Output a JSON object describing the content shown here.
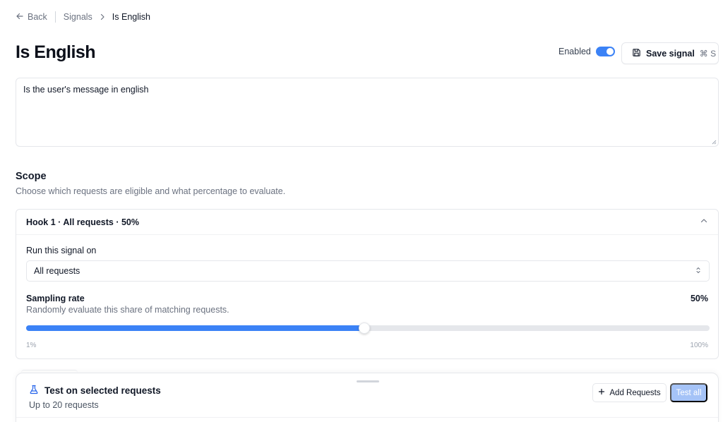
{
  "breadcrumb": {
    "back_label": "Back",
    "parent_label": "Signals",
    "current_label": "Is English"
  },
  "header": {
    "title": "Is English",
    "enabled_label": "Enabled",
    "enabled": true,
    "save_label": "Save signal",
    "save_shortcut": "⌘ S"
  },
  "prompt": {
    "value": "Is the user's message in english"
  },
  "scope": {
    "title": "Scope",
    "description": "Choose which requests are eligible and what percentage to evaluate.",
    "hook": {
      "header": "Hook 1 · All requests · 50%",
      "run_on_label": "Run this signal on",
      "run_on_value": "All requests",
      "sampling_label": "Sampling rate",
      "sampling_description": "Randomly evaluate this share of matching requests.",
      "sampling_value_label": "50%",
      "sampling_percent": 50,
      "slider_min_label": "1%",
      "slider_max_label": "100%",
      "slider_min": 1,
      "slider_max": 100
    }
  },
  "test_panel": {
    "title": "Test on selected requests",
    "subtitle": "Up to 20 requests",
    "add_label": "Add Requests",
    "test_all_label": "Test all"
  },
  "colors": {
    "accent": "#3b82f6",
    "accent_disabled": "#a5c3f7",
    "border": "#e5e7eb",
    "muted_text": "#6b7280"
  },
  "icons": {
    "back": "arrow-left-icon",
    "breadcrumb_sep": "chevron-right-icon",
    "save": "floppy-disk-icon",
    "collapse": "chevron-up-icon",
    "select": "chevron-up-down-icon",
    "test": "flask-icon",
    "add": "plus-icon"
  }
}
